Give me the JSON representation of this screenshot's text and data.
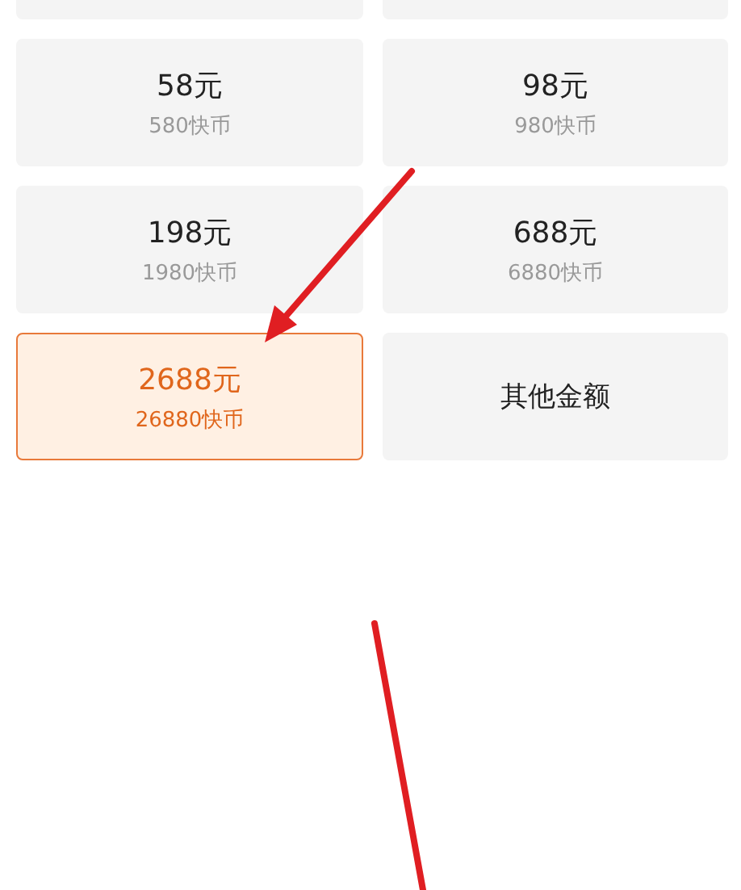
{
  "options": [
    {
      "kind": "cut",
      "selected": false
    },
    {
      "kind": "cut",
      "selected": false
    },
    {
      "kind": "package",
      "price": "58元",
      "coins": "580快币",
      "selected": false
    },
    {
      "kind": "package",
      "price": "98元",
      "coins": "980快币",
      "selected": false
    },
    {
      "kind": "package",
      "price": "198元",
      "coins": "1980快币",
      "selected": false
    },
    {
      "kind": "package",
      "price": "688元",
      "coins": "6880快币",
      "selected": false
    },
    {
      "kind": "package",
      "price": "2688元",
      "coins": "26880快币",
      "selected": true
    },
    {
      "kind": "custom",
      "label": "其他金额",
      "selected": false
    }
  ]
}
